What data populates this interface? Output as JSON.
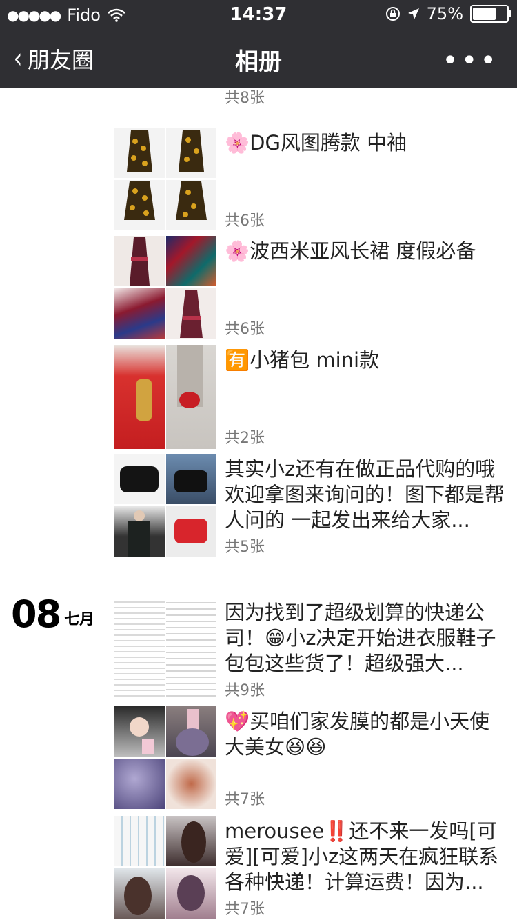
{
  "status_bar": {
    "signal": "●●●●●",
    "carrier": "Fido",
    "time": "14:37",
    "battery": "75%",
    "battery_level": 0.75
  },
  "nav": {
    "back_label": "朋友圈",
    "title": "相册",
    "more": "•••"
  },
  "date_group": {
    "day": "08",
    "month": "七月"
  },
  "entries": [
    {
      "caption": "",
      "count": "共8张"
    },
    {
      "caption": "🌸DG风图腾款 中袖",
      "count": "共6张"
    },
    {
      "caption": "🌸波西米亚风长裙 度假必备",
      "count": "共6张"
    },
    {
      "caption": "🈶小猪包 mini款",
      "count": "共2张"
    },
    {
      "caption": "其实小z还有在做正品代购的哦 欢迎拿图来询问的！图下都是帮人问的 一起发出来给大家...",
      "count": "共5张"
    },
    {
      "caption": "因为找到了超级划算的快递公司！😁小z决定开始进衣服鞋子包包这些货了！超级强大...",
      "count": "共9张"
    },
    {
      "caption": "💖买咱们家发膜的都是小天使大美女😆😆",
      "count": "共7张"
    },
    {
      "caption": "merousee‼️还不来一发吗[可爱][可爱]小z这两天在疯狂联系各种快递！计算运费！因为...",
      "count": "共7张"
    }
  ],
  "colors": {
    "nav_bg": "#2f2f33",
    "count_text": "#777777"
  }
}
